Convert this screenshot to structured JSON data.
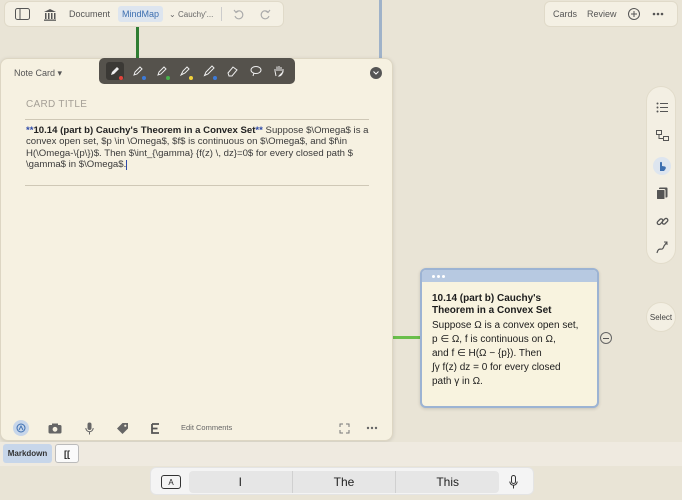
{
  "toolbar": {
    "document_label": "Document",
    "mindmap_label": "MindMap",
    "breadcrumb_label": "Cauchy'...",
    "cards_label": "Cards",
    "review_label": "Review"
  },
  "notecard": {
    "header_label": "Note Card",
    "card_title_placeholder": "CARD TITLE",
    "content_star_open": "**",
    "content_title": "10.14 (part b) Cauchy's Theorem in a Convex Set",
    "content_star_close": "**",
    "content_body": " Suppose $\\Omega$ is a convex open set, $p \\in \\Omega$, $f$ is continuous on $\\Omega$, and $f\\in H(\\Omega-\\{p\\})$. Then  $\\int_{\\gamma} {f(z) \\, dz}=0$ for every closed path $ \\gamma$ in $\\Omega$.",
    "edit_comments_label": "Edit Comments"
  },
  "node": {
    "title": "10.14 (part b) Cauchy's Theorem in a Convex Set",
    "line1": "Suppose Ω is a convex open set,",
    "line2": "p ∈ Ω, f is continuous on Ω,",
    "line3": "and f ∈ H(Ω − {p}). Then",
    "line4": "∫γ f(z) dz = 0 for every closed",
    "line5": "path γ in Ω."
  },
  "side": {
    "select_label": "Select"
  },
  "keyboard": {
    "markdown_label": "Markdown",
    "bracket_label": "[[",
    "a_key": "A",
    "suggestions": [
      "I",
      "The",
      "This"
    ]
  },
  "colors": {
    "accent_blue": "#3d6fb0",
    "branch_green": "#6abf4b",
    "node_border": "#9cb3d3"
  }
}
